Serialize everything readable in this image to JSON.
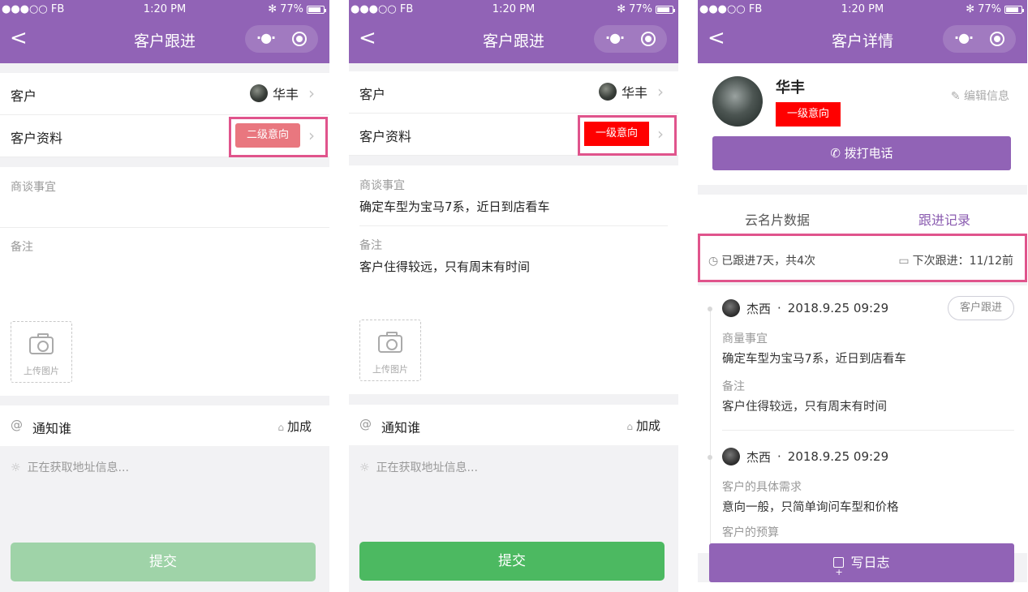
{
  "status_bar": {
    "carrier": "●●●○○ FB ",
    "time": "1:20 PM",
    "battery": "77%"
  },
  "screens": [
    {
      "nav_title": "客户跟进",
      "customer_label": "客户",
      "customer_name": "华丰",
      "profile_label": "客户资料",
      "intent_badge": "二级意向",
      "topic_label": "商谈事宜",
      "topic_value": "",
      "notes_label": "备注",
      "notes_value": "",
      "upload_label": "上传图片",
      "notify_label": "通知谁",
      "bonus_label": "加成",
      "location_text": "正在获取地址信息...",
      "submit_label": "提交"
    },
    {
      "nav_title": "客户跟进",
      "customer_label": "客户",
      "customer_name": "华丰",
      "profile_label": "客户资料",
      "intent_badge": "一级意向",
      "topic_label": "商谈事宜",
      "topic_value": "确定车型为宝马7系，近日到店看车",
      "notes_label": "备注",
      "notes_value": "客户住得较远，只有周末有时间",
      "upload_label": "上传图片",
      "notify_label": "通知谁",
      "bonus_label": "加成",
      "location_text": "正在获取地址信息...",
      "submit_label": "提交"
    },
    {
      "nav_title": "客户详情",
      "name": "华丰",
      "edit_label": "编辑信息",
      "intent_badge": "一级意向",
      "call_label": "拨打电话",
      "tabs": [
        "云名片数据",
        "跟进记录"
      ],
      "summary_left": "已跟进7天，共4次",
      "summary_right": "下次跟进：11/12前",
      "records": [
        {
          "author": "杰西",
          "datetime": "2018.9.25 09:29",
          "tag": "客户跟进",
          "label1": "商量事宜",
          "value1": "确定车型为宝马7系，近日到店看车",
          "label2": "备注",
          "value2": "客户住得较远，只有周末有时间"
        },
        {
          "author": "杰西",
          "datetime": "2018.9.25 09:29",
          "label1": "客户的具体需求",
          "value1": "意向一般，只简单询问车型和价格",
          "label2": "客户的预算"
        }
      ],
      "log_label": "写日志"
    }
  ],
  "colors": {
    "nav_purple": "#9163b6",
    "highlight_pink": "#e0548c",
    "badge_red": "#ff0000",
    "badge_faded": "#e9777f",
    "submit_green": "#4cb961",
    "submit_disabled": "#9fd3a8"
  },
  "icons": [
    "back-chevron-icon",
    "more-dots-icon",
    "target-icon",
    "camera-icon",
    "at-icon",
    "lock-icon",
    "location-icon",
    "phone-icon",
    "clock-icon",
    "calendar-icon",
    "add-square-icon"
  ]
}
